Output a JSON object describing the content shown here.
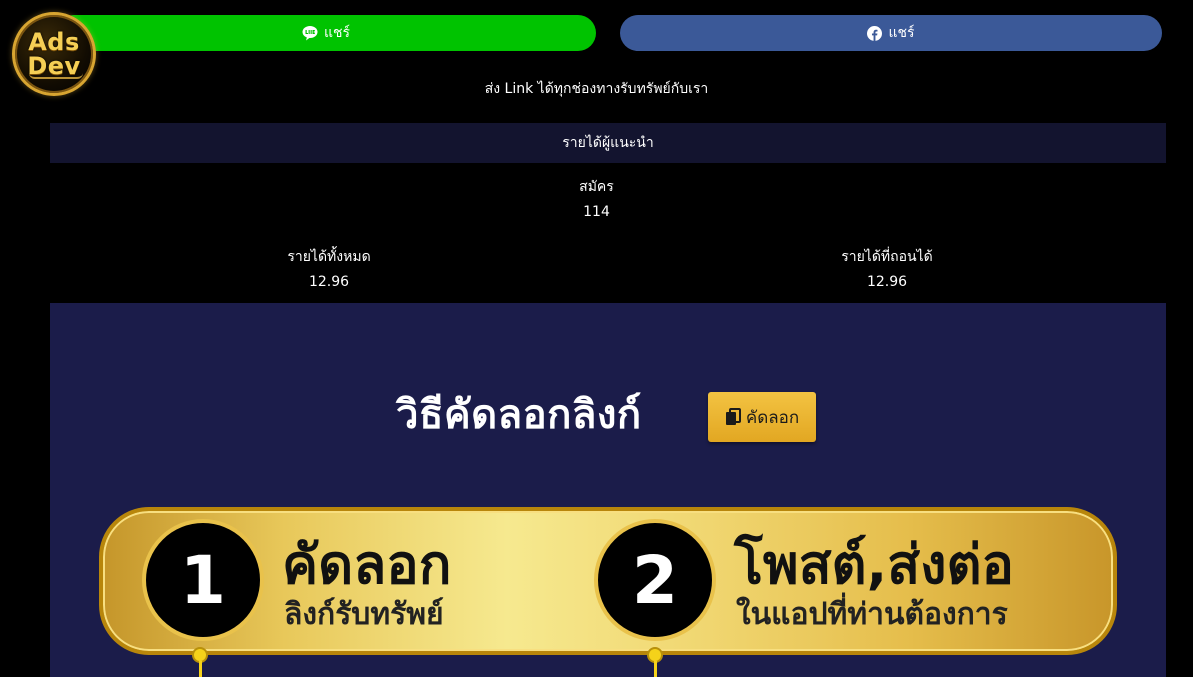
{
  "logo": {
    "line1": "Ads",
    "line2": "Dev"
  },
  "share": {
    "line_label": "แชร์",
    "line_icon": "line-chat-icon",
    "facebook_label": "แชร์",
    "facebook_icon": "facebook-icon",
    "line_color": "#00c300",
    "facebook_color": "#3b5998"
  },
  "invite_text": "ส่ง Link ได้ทุกช่องทางรับทรัพย์กับเรา",
  "referral": {
    "header": "รายได้ผู้แนะนำ",
    "signup_label": "สมัคร",
    "signup_value": "114",
    "total_income_label": "รายได้ทั้งหมด",
    "total_income_value": "12.96",
    "withdrawable_label": "รายได้ที่ถอนได้",
    "withdrawable_value": "12.96"
  },
  "banner": {
    "title": "วิธีคัดลอกลิงก์",
    "copy_badge_label": "คัดลอก",
    "copy_icon": "copy-icon",
    "step1_number": "1",
    "step1_title": "คัดลอก",
    "step1_subtitle": "ลิงก์รับทรัพย์",
    "step2_number": "2",
    "step2_title": "โพสต์,ส่งต่อ",
    "step2_subtitle": "ในแอปที่ท่านต้องการ"
  }
}
